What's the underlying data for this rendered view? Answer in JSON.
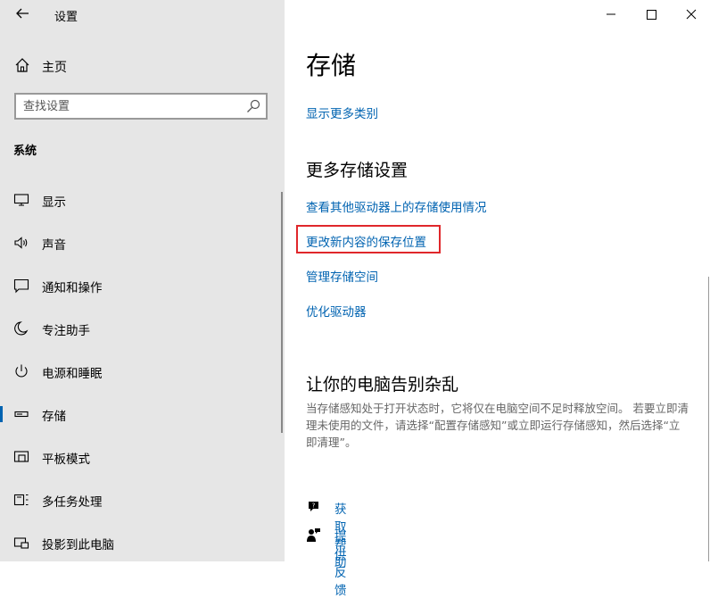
{
  "window": {
    "title": "设置",
    "back_icon": "arrow-left-icon",
    "minimize_icon": "minimize-icon",
    "maximize_icon": "maximize-icon",
    "close_icon": "close-icon"
  },
  "sidebar": {
    "home": {
      "label": "主页",
      "icon": "home-icon"
    },
    "search": {
      "placeholder": "查找设置",
      "value": "",
      "icon": "search-icon"
    },
    "section_title": "系统",
    "items": [
      {
        "label": "显示",
        "icon": "monitor-icon",
        "selected": false
      },
      {
        "label": "声音",
        "icon": "speaker-icon",
        "selected": false
      },
      {
        "label": "通知和操作",
        "icon": "notification-icon",
        "selected": false
      },
      {
        "label": "专注助手",
        "icon": "moon-icon",
        "selected": false
      },
      {
        "label": "电源和睡眠",
        "icon": "power-icon",
        "selected": false
      },
      {
        "label": "存储",
        "icon": "storage-icon",
        "selected": true
      },
      {
        "label": "平板模式",
        "icon": "tablet-mode-icon",
        "selected": false
      },
      {
        "label": "多任务处理",
        "icon": "multitask-icon",
        "selected": false
      },
      {
        "label": "投影到此电脑",
        "icon": "project-icon",
        "selected": false
      }
    ]
  },
  "main": {
    "title": "存储",
    "show_more_link": "显示更多类别",
    "more_settings_heading": "更多存储设置",
    "links": [
      "查看其他驱动器上的存储使用情况",
      "更改新内容的保存位置",
      "管理存储空间",
      "优化驱动器"
    ],
    "declutter_heading": "让你的电脑告别杂乱",
    "declutter_desc": "当存储感知处于打开状态时，它将仅在电脑空间不足时释放空间。 若要立即清理未使用的文件，请选择“配置存储感知”或立即运行存储感知，然后选择“立即清理”。",
    "help": [
      {
        "label": "获取帮助",
        "icon": "help-chat-icon"
      },
      {
        "label": "提供反馈",
        "icon": "feedback-icon"
      }
    ]
  },
  "colors": {
    "accent": "#0063b1",
    "sidebar_bg": "#e6e6e6",
    "highlight": "#e0272b"
  }
}
